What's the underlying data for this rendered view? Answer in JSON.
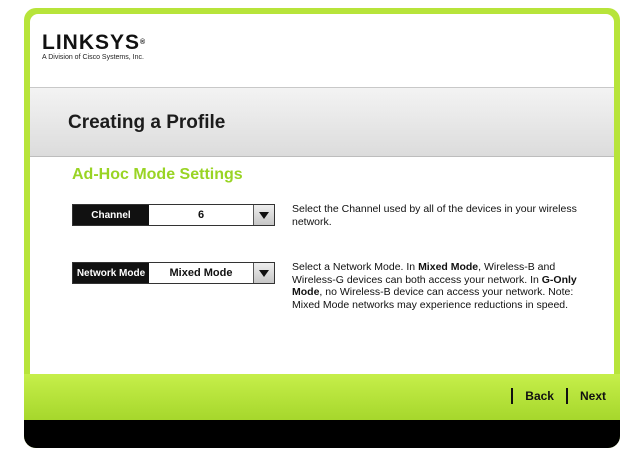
{
  "brand": {
    "name": "LINKSYS",
    "registered": "®",
    "tagline": "A Division of Cisco Systems, Inc."
  },
  "page": {
    "title": "Creating a Profile"
  },
  "section": {
    "heading": "Ad-Hoc Mode Settings"
  },
  "fields": {
    "channel": {
      "label": "Channel",
      "value": "6",
      "description": "Select the Channel used by all of the devices in your wireless network."
    },
    "network_mode": {
      "label": "Network Mode",
      "value": "Mixed Mode",
      "desc": {
        "p1": "Select a Network Mode. In ",
        "b1": "Mixed Mode",
        "p2": ", Wireless-B and Wireless-G devices can both access your network. In ",
        "b2": "G-Only Mode",
        "p3": ", no Wireless-B device can access your network. Note: Mixed Mode networks may experience reductions in speed."
      }
    }
  },
  "nav": {
    "back": "Back",
    "next": "Next"
  },
  "icons": {
    "dropdown": "chevron-down-icon"
  },
  "colors": {
    "accent_green": "#b7e43a",
    "heading_green": "#99d424",
    "black": "#000000"
  }
}
